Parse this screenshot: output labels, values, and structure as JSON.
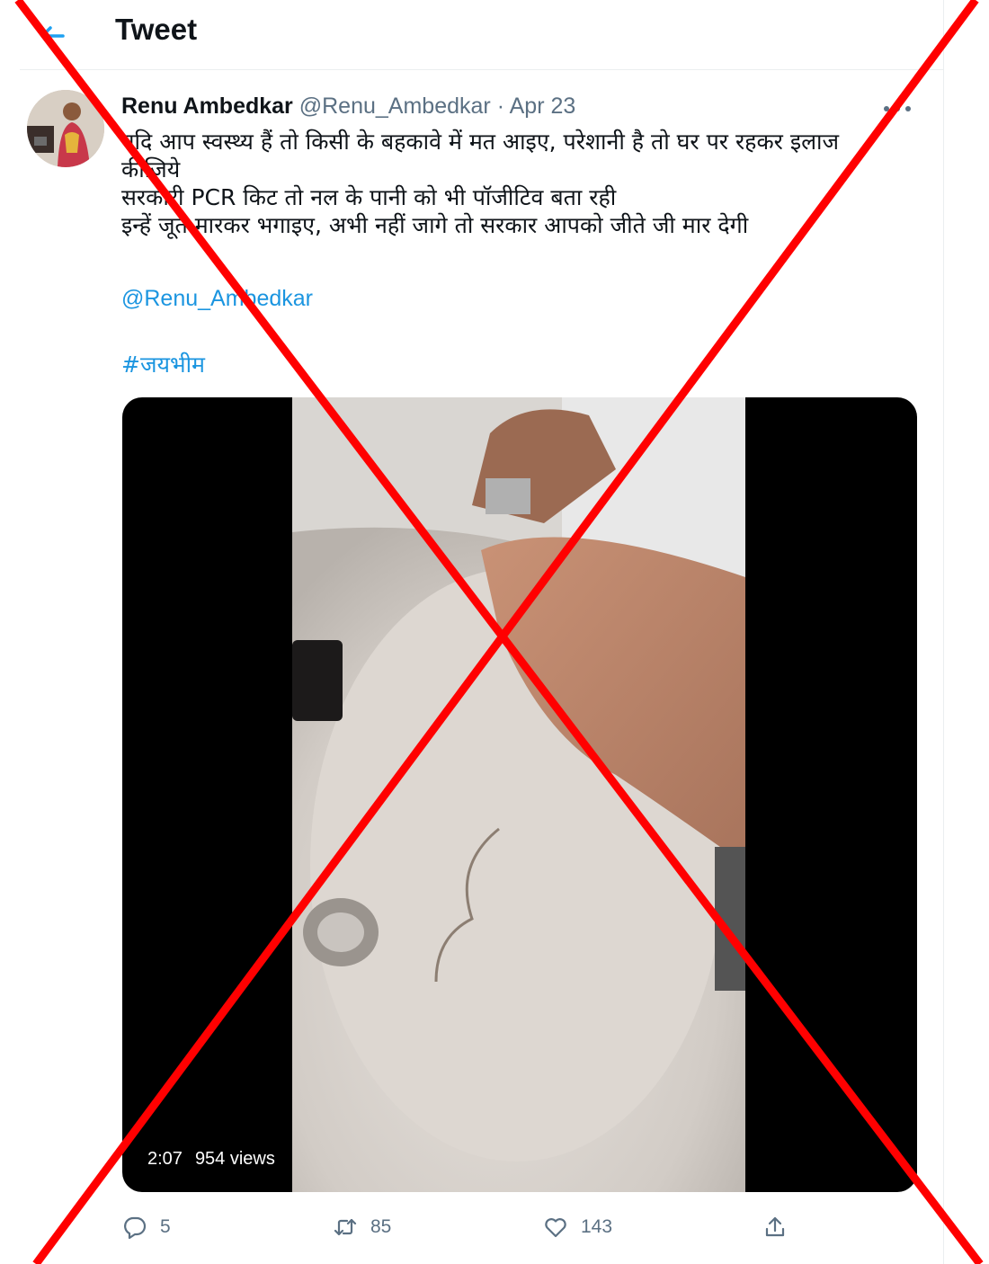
{
  "header": {
    "title": "Tweet"
  },
  "tweet": {
    "author_name": "Renu Ambedkar",
    "author_handle": "@Renu_Ambedkar",
    "separator": "·",
    "date": "Apr 23",
    "text_lines": [
      "यदि आप स्वस्थ्य हैं तो किसी के बहकावे में मत आइए, परेशानी है तो घर पर रहकर इलाज",
      "कीजिये",
      "सरकारी PCR किट तो नल के पानी को भी पॉजीटिव बता रही",
      "इन्हें जूते मारकर भगाइए, अभी नहीं जागे तो सरकार आपको जीते जी मार देगी"
    ],
    "mention": "@Renu_Ambedkar",
    "hashtag": "#जयभीम"
  },
  "media": {
    "duration": "2:07",
    "views": "954 views"
  },
  "actions": {
    "replies": "5",
    "retweets": "85",
    "likes": "143"
  },
  "icons": {
    "back": "back-arrow-icon",
    "more": "more-horizontal-icon",
    "reply": "reply-icon",
    "retweet": "retweet-icon",
    "like": "heart-icon",
    "share": "share-icon"
  },
  "colors": {
    "accent": "#1da1f2",
    "link": "#1b95e0",
    "secondary": "#5b7083",
    "overlay_cross": "#ff0000"
  }
}
